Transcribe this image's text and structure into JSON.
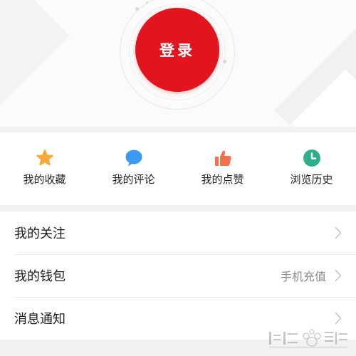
{
  "login": {
    "label": "登录"
  },
  "quick_actions": [
    {
      "label": "我的收藏",
      "icon": "star-icon",
      "color": "#f6a83c"
    },
    {
      "label": "我的评论",
      "icon": "comment-bubble-icon",
      "color": "#3a9bf0"
    },
    {
      "label": "我的点赞",
      "icon": "thumbs-up-icon",
      "color": "#f2714b"
    },
    {
      "label": "浏览历史",
      "icon": "clock-icon",
      "color": "#2fae8c"
    }
  ],
  "menu": [
    {
      "label": "我的关注",
      "extra": ""
    },
    {
      "label": "我的钱包",
      "extra": "手机充值"
    },
    {
      "label": "消息通知",
      "extra": ""
    }
  ],
  "colors": {
    "brand_red": "#e2141e",
    "background": "#f2f2f2",
    "text_primary": "#1a1a1a",
    "text_secondary": "#8a8a8a"
  }
}
